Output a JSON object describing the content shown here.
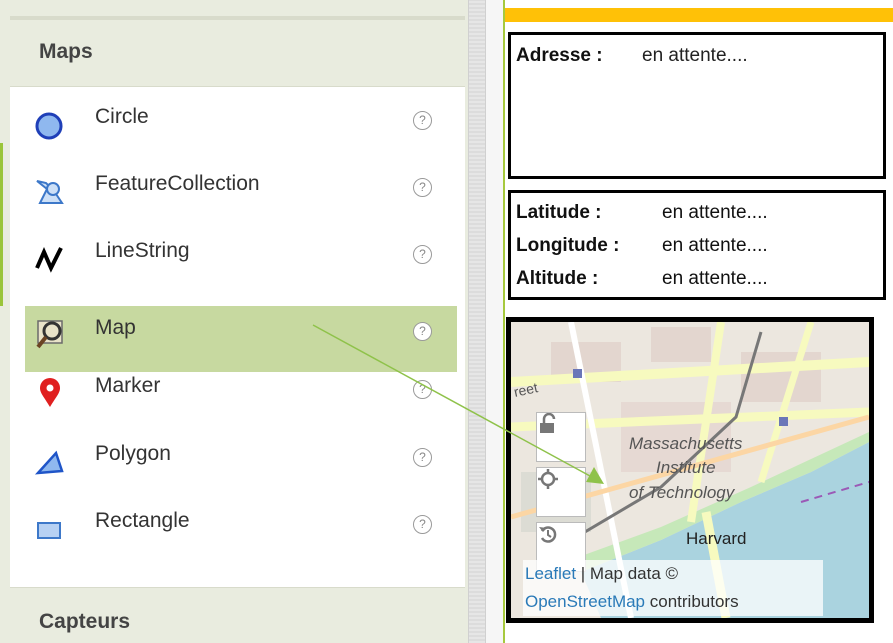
{
  "palette": {
    "section_title": "Maps",
    "items": [
      {
        "label": "Circle",
        "icon": "circle-icon",
        "help": "?"
      },
      {
        "label": "FeatureCollection",
        "icon": "feature-collection-icon",
        "help": "?"
      },
      {
        "label": "LineString",
        "icon": "linestring-icon",
        "help": "?"
      },
      {
        "label": "Map",
        "icon": "map-icon",
        "help": "?",
        "selected": true
      },
      {
        "label": "Marker",
        "icon": "marker-icon",
        "help": "?"
      },
      {
        "label": "Polygon",
        "icon": "polygon-icon",
        "help": "?"
      },
      {
        "label": "Rectangle",
        "icon": "rectangle-icon",
        "help": "?"
      }
    ],
    "next_section_title": "Capteurs"
  },
  "viewer": {
    "adresse_label": "Adresse :",
    "adresse_value": "en attente....",
    "latitude_label": "Latitude :",
    "latitude_value": "en attente....",
    "longitude_label": "Longitude :",
    "longitude_value": "en attente....",
    "altitude_label": "Altitude :",
    "altitude_value": "en attente....",
    "map": {
      "place_label_1": "Massachusetts",
      "place_label_2": "Institute",
      "place_label_3": "of Technology",
      "place_label_harvard": "Harvard",
      "street_label": "reet",
      "attribution_link_1": "Leaflet",
      "attribution_sep": "| Map data ©",
      "attribution_link_2": "OpenStreetMap",
      "attribution_tail": "contributors"
    }
  },
  "colors": {
    "accent_green": "#9ac53a",
    "selected_bg": "#c7d9a0",
    "title_bar": "#ffc107",
    "link": "#2a7ab8"
  }
}
